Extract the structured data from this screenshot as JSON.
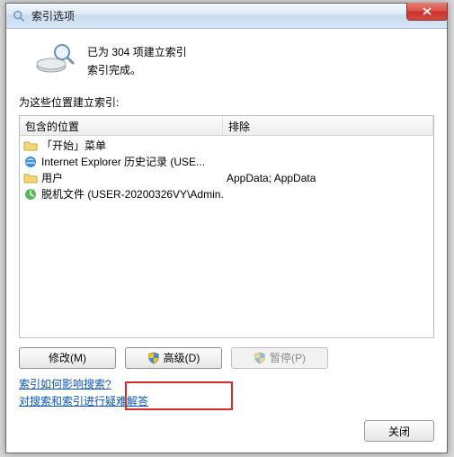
{
  "window": {
    "title": "索引选项"
  },
  "status": {
    "line1": "已为 304 项建立索引",
    "line2": "索引完成。"
  },
  "section_label": "为这些位置建立索引:",
  "columns": {
    "c1": "包含的位置",
    "c2": "排除"
  },
  "rows": [
    {
      "icon": "folder",
      "label": "「开始」菜单",
      "exclude": ""
    },
    {
      "icon": "ie",
      "label": "Internet Explorer 历史记录 (USE...",
      "exclude": ""
    },
    {
      "icon": "folder",
      "label": "用户",
      "exclude": "AppData; AppData"
    },
    {
      "icon": "offline",
      "label": "脱机文件 (USER-20200326VY\\Admin...",
      "exclude": ""
    }
  ],
  "buttons": {
    "modify": "修改(M)",
    "advanced": "高级(D)",
    "pause": "暂停(P)",
    "close": "关闭"
  },
  "links": {
    "l1": "索引如何影响搜索?",
    "l2": "对搜索和索引进行疑难解答"
  }
}
